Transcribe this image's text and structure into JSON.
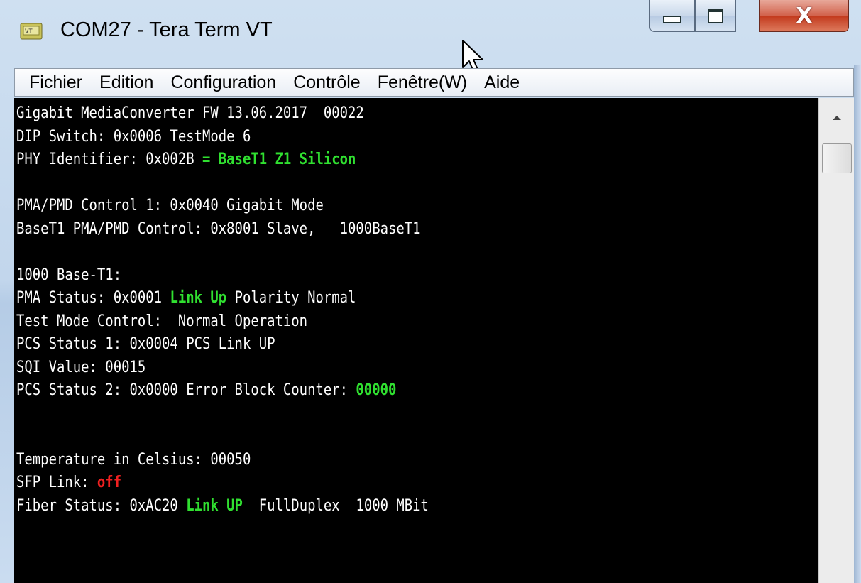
{
  "window": {
    "title": "COM27 - Tera Term VT",
    "controls": {
      "close_label": "X"
    }
  },
  "menu": [
    "Fichier",
    "Edition",
    "Configuration",
    "Contrôle",
    "Fenêtre(W)",
    "Aide"
  ],
  "terminal": {
    "lines": [
      {
        "segments": [
          {
            "text": "Gigabit MediaConverter FW 13.06.2017  00022"
          }
        ]
      },
      {
        "segments": [
          {
            "text": "DIP Switch: 0x0006 TestMode 6"
          }
        ]
      },
      {
        "segments": [
          {
            "text": "PHY Identifier: 0x002B "
          },
          {
            "text": "= BaseT1 Z1 Silicon",
            "color": "green"
          }
        ]
      },
      {
        "segments": [
          {
            "text": ""
          }
        ]
      },
      {
        "segments": [
          {
            "text": "PMA/PMD Control 1: 0x0040 Gigabit Mode"
          }
        ]
      },
      {
        "segments": [
          {
            "text": "BaseT1 PMA/PMD Control: 0x8001 Slave,   1000BaseT1"
          }
        ]
      },
      {
        "segments": [
          {
            "text": ""
          }
        ]
      },
      {
        "segments": [
          {
            "text": "1000 Base-T1:"
          }
        ]
      },
      {
        "segments": [
          {
            "text": "PMA Status: 0x0001 "
          },
          {
            "text": "Link Up",
            "color": "green"
          },
          {
            "text": " Polarity Normal"
          }
        ]
      },
      {
        "segments": [
          {
            "text": "Test Mode Control:  Normal Operation"
          }
        ]
      },
      {
        "segments": [
          {
            "text": "PCS Status 1: 0x0004 PCS Link UP"
          }
        ]
      },
      {
        "segments": [
          {
            "text": "SQI Value: 00015"
          }
        ]
      },
      {
        "segments": [
          {
            "text": "PCS Status 2: 0x0000 Error Block Counter: "
          },
          {
            "text": "00000",
            "color": "green"
          }
        ]
      },
      {
        "segments": [
          {
            "text": ""
          }
        ]
      },
      {
        "segments": [
          {
            "text": ""
          }
        ]
      },
      {
        "segments": [
          {
            "text": "Temperature in Celsius: 00050"
          }
        ]
      },
      {
        "segments": [
          {
            "text": "SFP Link: "
          },
          {
            "text": "off",
            "color": "red"
          }
        ]
      },
      {
        "segments": [
          {
            "text": "Fiber Status: 0xAC20 "
          },
          {
            "text": "Link UP",
            "color": "green"
          },
          {
            "text": "  FullDuplex  1000 MBit"
          }
        ]
      }
    ]
  },
  "colors": {
    "terminal_bg": "#000000",
    "terminal_fg": "#ffffff",
    "green": "#30e030",
    "red": "#f02020"
  }
}
